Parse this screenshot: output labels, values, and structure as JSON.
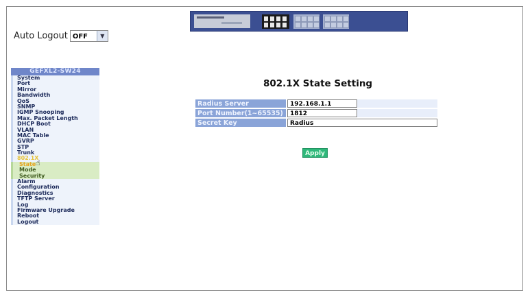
{
  "auto_logout": {
    "label": "Auto Logout",
    "value": "OFF"
  },
  "menu": {
    "title": "GEFXL2-SW24",
    "items": [
      {
        "label": "System"
      },
      {
        "label": "Port"
      },
      {
        "label": "Mirror"
      },
      {
        "label": "Bandwidth"
      },
      {
        "label": "QoS"
      },
      {
        "label": "SNMP"
      },
      {
        "label": "IGMP Snooping"
      },
      {
        "label": "Max. Packet Length"
      },
      {
        "label": "DHCP Boot"
      },
      {
        "label": "VLAN"
      },
      {
        "label": "MAC Table"
      },
      {
        "label": "GVRP"
      },
      {
        "label": "STP"
      },
      {
        "label": "Trunk"
      },
      {
        "label": "802.1X"
      },
      {
        "label": "State"
      },
      {
        "label": "Mode"
      },
      {
        "label": "Security"
      },
      {
        "label": "Alarm"
      },
      {
        "label": "Configuration"
      },
      {
        "label": "Diagnostics"
      },
      {
        "label": "TFTP Server"
      },
      {
        "label": "Log"
      },
      {
        "label": "Firmware Upgrade"
      },
      {
        "label": "Reboot"
      },
      {
        "label": "Logout"
      }
    ]
  },
  "page": {
    "title": "802.1X State Setting",
    "fields": [
      {
        "label": "Radius Server",
        "value": "192.168.1.1"
      },
      {
        "label": "Port Number(1~65535)",
        "value": "1812"
      },
      {
        "label": "Secret Key",
        "value": "Radius"
      }
    ],
    "apply_label": "Apply"
  },
  "colors": {
    "menu_header": "#6f86c9",
    "label_cell": "#8aa4d8",
    "apply_button": "#2eb87a",
    "banner": "#3b4f92"
  }
}
